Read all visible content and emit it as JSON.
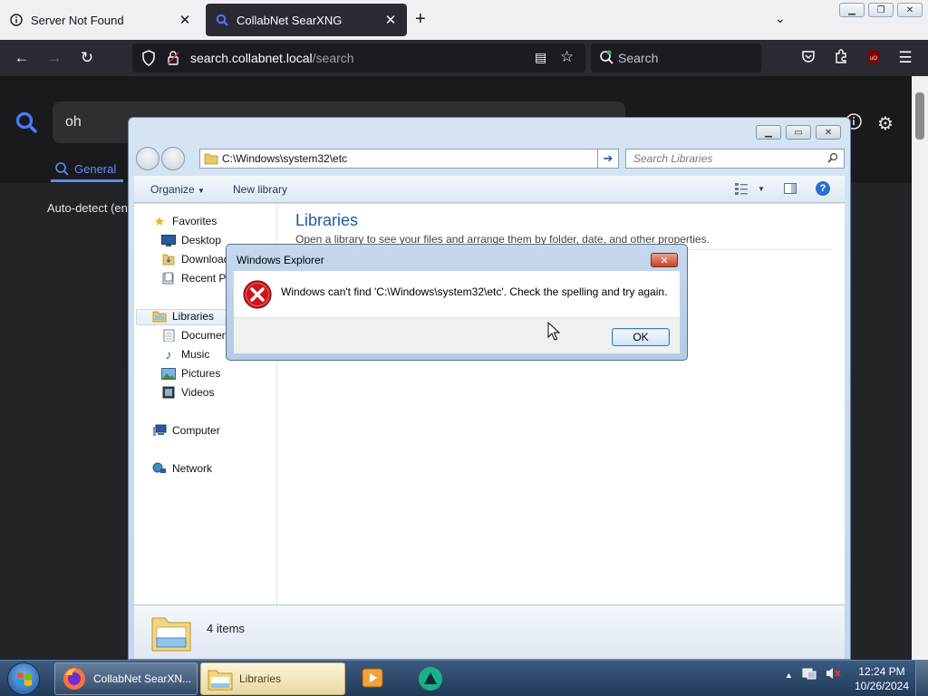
{
  "browser": {
    "tabs": [
      {
        "title": "Server Not Found",
        "active": false
      },
      {
        "title": "CollabNet SearXNG",
        "active": true
      }
    ],
    "url": {
      "host": "search.collabnet.local",
      "path": "/search"
    },
    "search_placeholder": "Search"
  },
  "searx": {
    "query": "oh",
    "category": "General",
    "autodetect": "Auto-detect (en"
  },
  "explorer": {
    "address": "C:\\Windows\\system32\\etc",
    "search_placeholder": "Search Libraries",
    "toolbar": {
      "organize": "Organize",
      "new_library": "New library"
    },
    "nav": {
      "favorites": "Favorites",
      "desktop": "Desktop",
      "downloads": "Downloads",
      "recent": "Recent Places",
      "libraries": "Libraries",
      "documents": "Documents",
      "music": "Music",
      "pictures": "Pictures",
      "videos": "Videos",
      "computer": "Computer",
      "network": "Network"
    },
    "content": {
      "title": "Libraries",
      "subtitle": "Open a library to see your files and arrange them by folder, date, and other properties."
    },
    "details": {
      "count": "4 items"
    }
  },
  "dialog": {
    "title": "Windows Explorer",
    "message": "Windows can't find 'C:\\Windows\\system32\\etc'.  Check the spelling and try again.",
    "ok": "OK"
  },
  "taskbar": {
    "firefox": "CollabNet SearXN...",
    "libraries": "Libraries",
    "time": "12:24 PM",
    "date": "10/26/2024"
  },
  "colors": {
    "accent": "#5e8bff",
    "explorer_title": "#1e5aa8",
    "error": "#c8171e"
  }
}
